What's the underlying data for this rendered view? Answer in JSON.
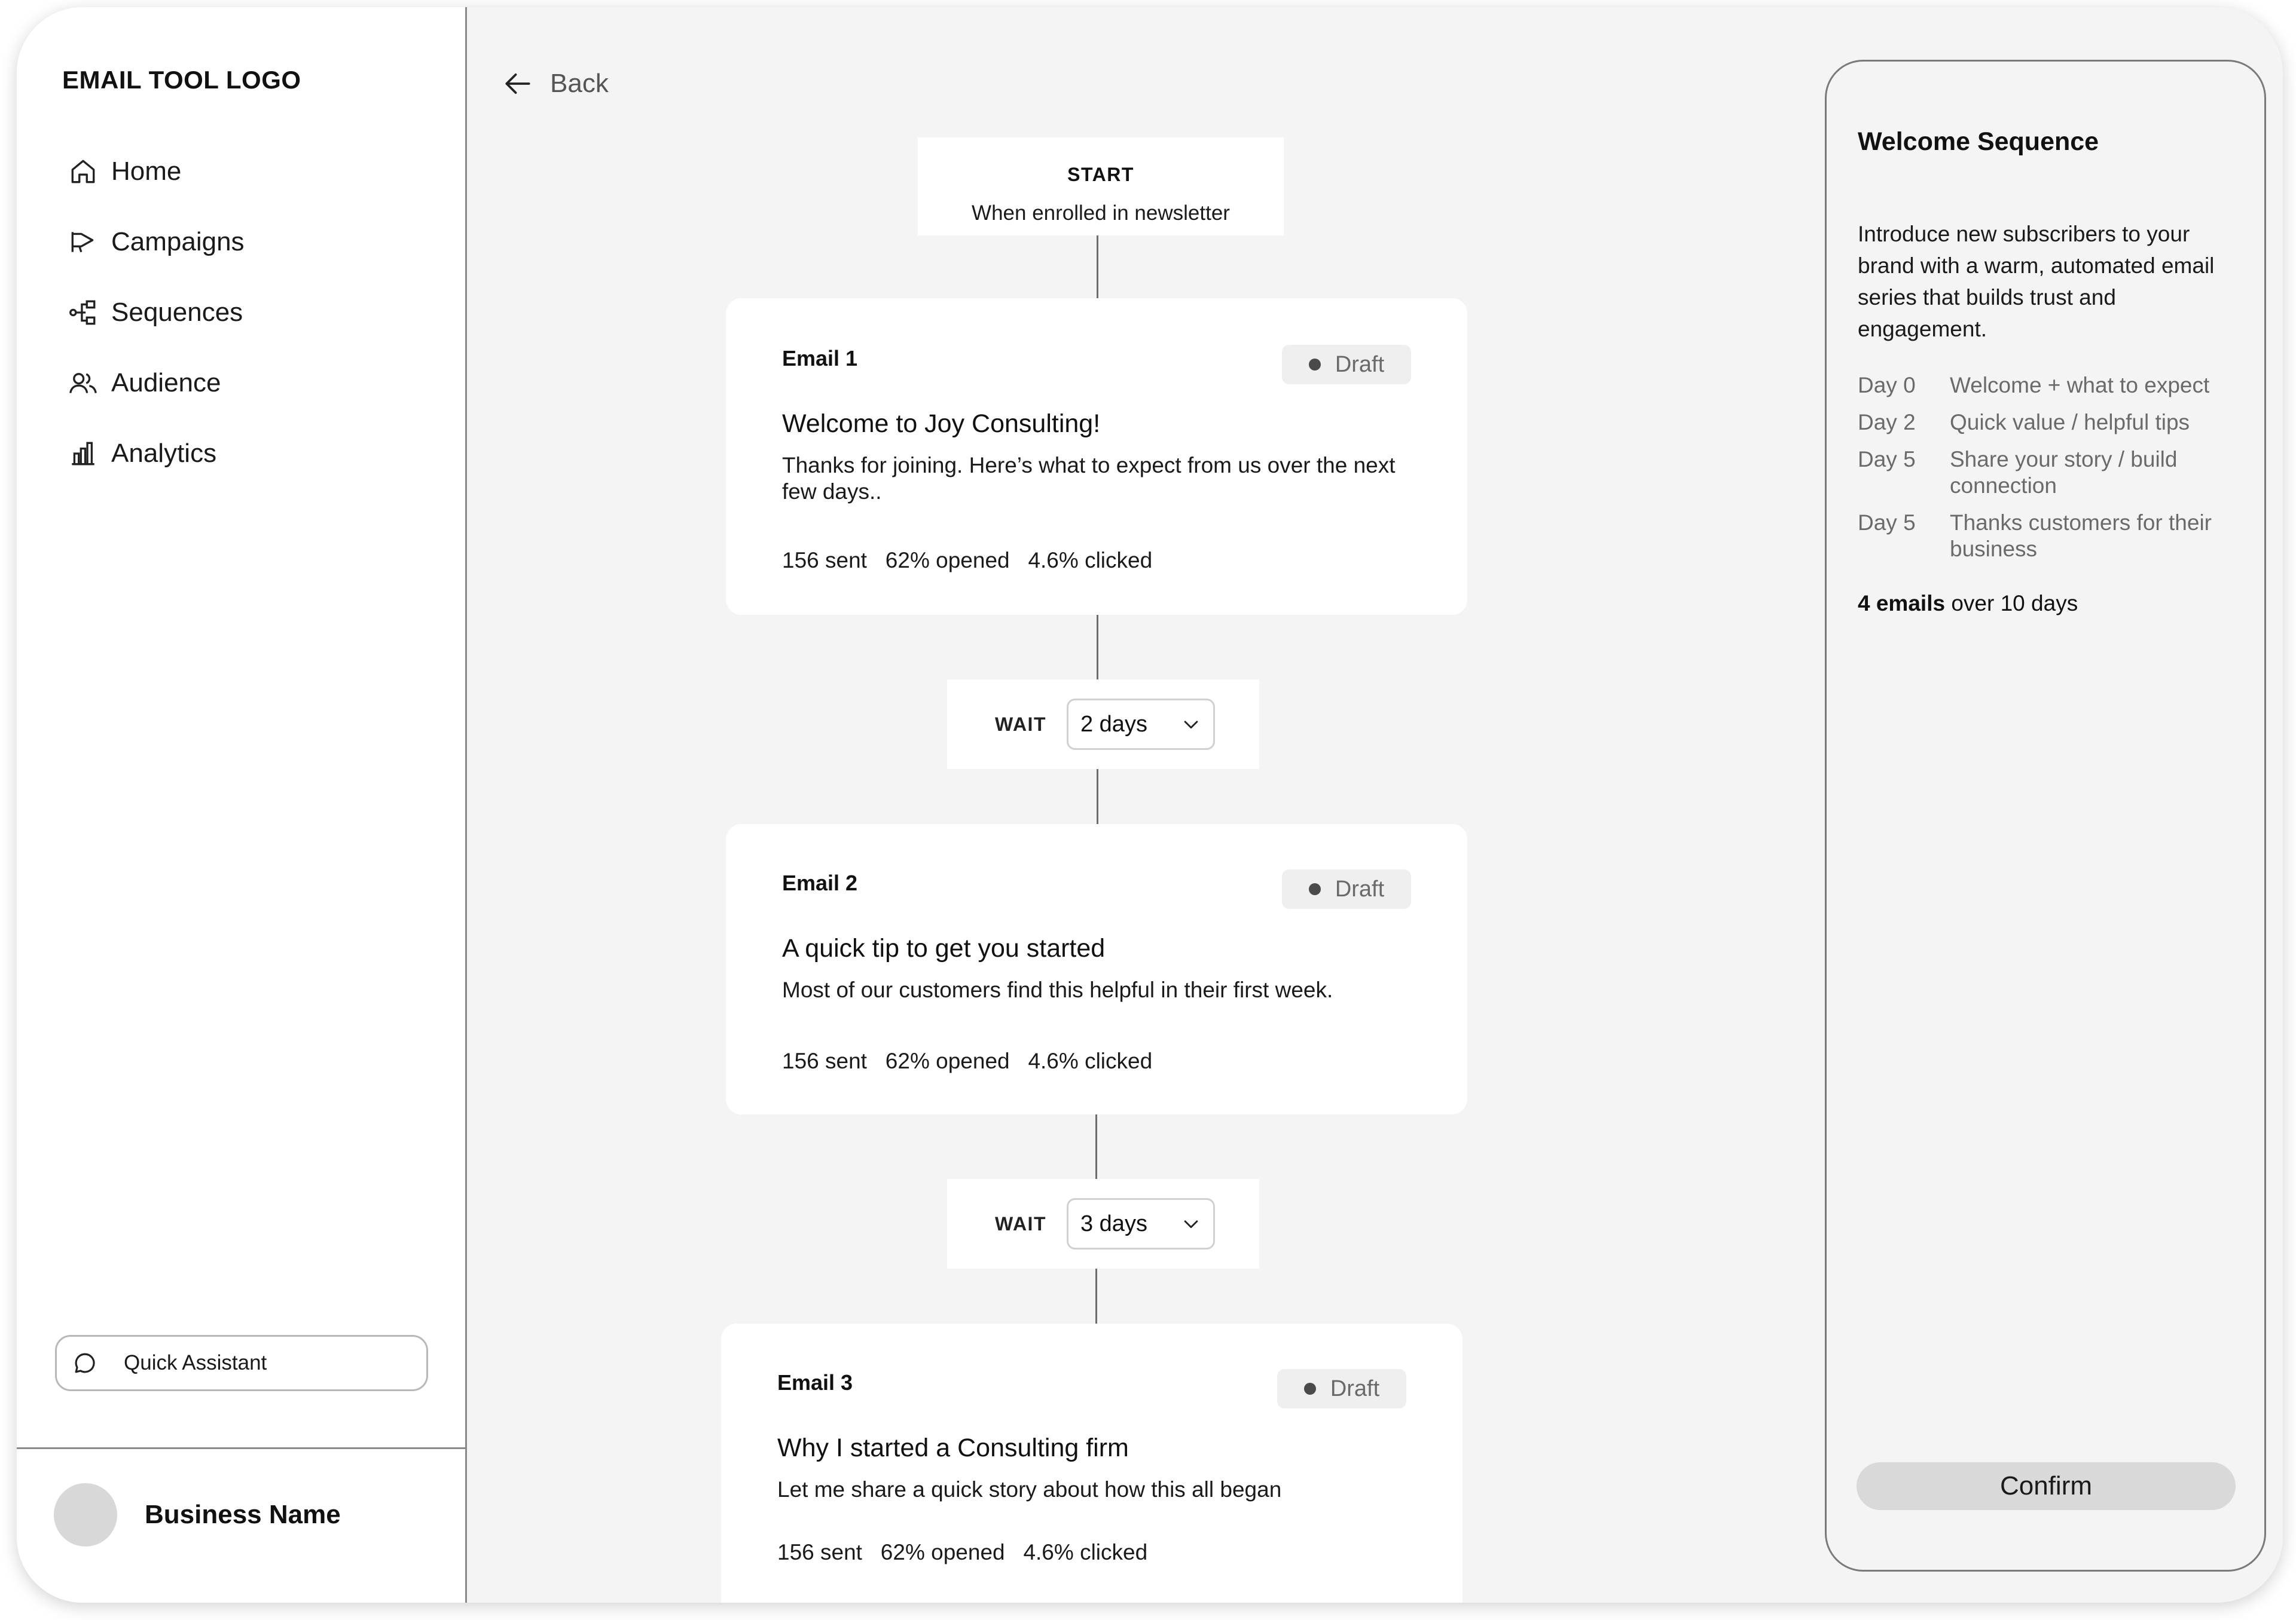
{
  "sidebar": {
    "logo": "EMAIL TOOL LOGO",
    "nav": [
      {
        "label": "Home",
        "icon": "home-icon"
      },
      {
        "label": "Campaigns",
        "icon": "megaphone-icon"
      },
      {
        "label": "Sequences",
        "icon": "sequence-flow-icon"
      },
      {
        "label": "Audience",
        "icon": "users-icon"
      },
      {
        "label": "Analytics",
        "icon": "bar-chart-icon"
      }
    ],
    "assistant_label": "Quick Assistant",
    "business_name": "Business Name"
  },
  "back_label": "Back",
  "flow": {
    "start": {
      "title": "START",
      "subtitle": "When enrolled in newsletter"
    },
    "emails": [
      {
        "label": "Email 1",
        "status": "Draft",
        "subject": "Welcome to Joy Consulting!",
        "preview": "Thanks for joining. Here’s what to expect from us over the next few days..",
        "stats": {
          "sent": "156 sent",
          "opened": "62% opened",
          "clicked": "4.6% clicked"
        }
      },
      {
        "label": "Email 2",
        "status": "Draft",
        "subject": "A quick tip to get you started",
        "preview": "Most of our customers find this helpful in their first week.",
        "stats": {
          "sent": "156 sent",
          "opened": "62% opened",
          "clicked": "4.6% clicked"
        }
      },
      {
        "label": "Email 3",
        "status": "Draft",
        "subject": "Why I started a Consulting firm",
        "preview": "Let me share a quick story about how this all began",
        "stats": {
          "sent": "156 sent",
          "opened": "62% opened",
          "clicked": "4.6% clicked"
        }
      }
    ],
    "waits": [
      {
        "label": "WAIT",
        "value": "2 days"
      },
      {
        "label": "WAIT",
        "value": "3 days"
      }
    ]
  },
  "panel": {
    "title": "Welcome Sequence",
    "description": "Introduce new subscribers to your brand with a warm, automated email series that builds trust and engagement.",
    "schedule": [
      {
        "day": "Day 0",
        "desc": "Welcome + what to expect"
      },
      {
        "day": "Day 2",
        "desc": "Quick value / helpful tips"
      },
      {
        "day": "Day 5",
        "desc": "Share your story / build connection"
      },
      {
        "day": "Day 5",
        "desc": "Thanks customers for their business"
      }
    ],
    "summary_bold": "4 emails",
    "summary_rest": " over 10 days",
    "confirm_label": "Confirm"
  },
  "colors": {
    "canvas": "#f4f4f4",
    "card": "#ffffff",
    "divider": "#8a8a8a",
    "muted_text": "#6a6a6a",
    "pill_bg": "#efefef",
    "confirm_bg": "#d9d9d9"
  }
}
